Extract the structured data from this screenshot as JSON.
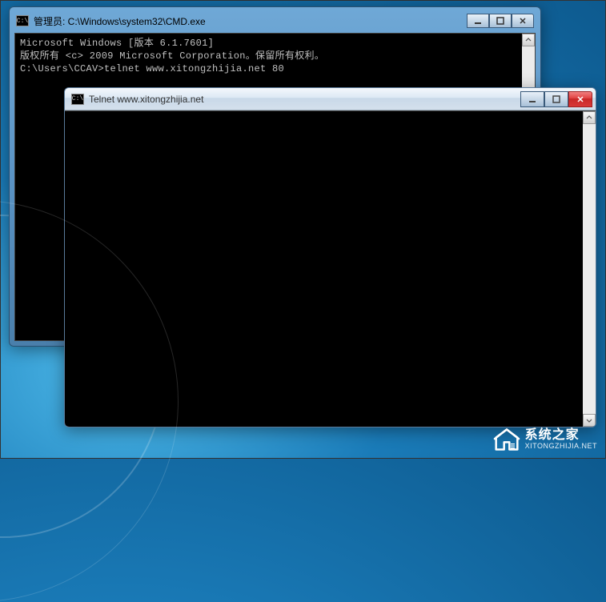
{
  "cmd_window": {
    "title": "管理员: C:\\Windows\\system32\\CMD.exe",
    "lines": {
      "l1": "Microsoft Windows [版本 6.1.7601]",
      "l2": "版权所有 <c> 2009 Microsoft Corporation。保留所有权利。",
      "l3": "",
      "l4": "C:\\Users\\CCAV>telnet www.xitongzhijia.net 80"
    }
  },
  "telnet_window": {
    "title": "Telnet www.xitongzhijia.net"
  },
  "icons": {
    "cmd_glyph": "C:\\"
  },
  "watermark": {
    "cn": "系统之家",
    "en": "XITONGZHIJIA.NET"
  }
}
